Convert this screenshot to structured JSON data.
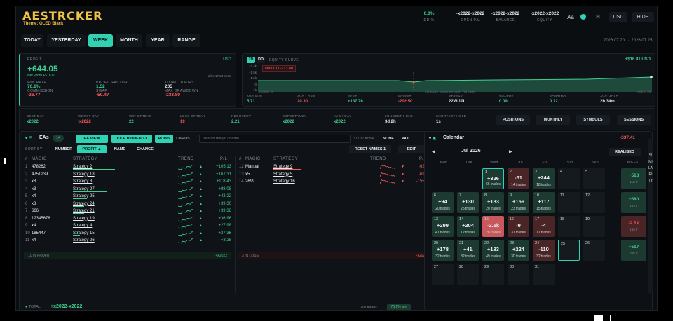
{
  "header": {
    "logo": "AESTRCKER",
    "theme": "Theme: OLED Black",
    "stats": [
      {
        "value": "0.0%",
        "label": "DD %",
        "color": "#3fd08f"
      },
      {
        "value": "-x2022-x2022",
        "label": "OPEN P/L",
        "color": "#e8ecef"
      },
      {
        "value": "-x2022-x2022",
        "label": "BALANCE",
        "color": "#e8ecef"
      },
      {
        "value": "-x2022-x2022",
        "label": "EQUITY",
        "color": "#e8ecef"
      }
    ],
    "aa": "Aa",
    "currency": "USD",
    "hide": "HIDE"
  },
  "tabs": [
    "TODAY",
    "YESTERDAY",
    "WEEK",
    "MONTH",
    "YEAR",
    "RANGE"
  ],
  "active_tab": "WEEK",
  "date_range": {
    "from": "2026.07.20",
    "arrow": "→",
    "to": "2026.07.25"
  },
  "profit": {
    "label": "PROFIT",
    "currency": "USD",
    "value": "+644.05",
    "net": "Net Profit +$16.81",
    "note": "after 17.24 costs",
    "stats": [
      {
        "l": "WIN RATE",
        "v": "76.1%",
        "c": "#3fd08f"
      },
      {
        "l": "PROFIT FACTOR",
        "v": "1.52",
        "c": "#3fd08f"
      },
      {
        "l": "TOTAL TRADES",
        "v": "205",
        "c": "#e8ecef"
      },
      {
        "l": "COMMISSION",
        "v": "-26.77",
        "c": "#ff5a5a"
      },
      {
        "l": "SWAP",
        "v": "-50.47",
        "c": "#ff5a5a"
      },
      {
        "l": "MAX DRAWDOWN",
        "v": "-233.80",
        "c": "#ff5a5a"
      }
    ]
  },
  "equity": {
    "btn1": "1D",
    "btn2": "DD",
    "title": "EQUITY CURVE",
    "total": "+$16.81 USD",
    "max_dd": "Max DD -233.80",
    "y_ticks": [
      "+2.4k",
      "+1.5k",
      "-1.5k",
      "0",
      "-1k"
    ],
    "x_from": "2026.07.20",
    "x_to": "2026.07.25",
    "mid_note": "231 trades · ignore net profit / 706 trades",
    "stats": [
      {
        "l": "AVG WIN",
        "v": "5.71",
        "c": "#3fd08f"
      },
      {
        "l": "AVG LOSS",
        "v": "20.30",
        "c": "#ff5a5a"
      },
      {
        "l": "BEST",
        "v": "+137.76",
        "c": "#3fd08f"
      },
      {
        "l": "WORST",
        "v": "-202.50",
        "c": "#ff5a5a"
      },
      {
        "l": "STREAK",
        "v": "22W/10L",
        "c": "#e8ecef"
      },
      {
        "l": "SHARPE",
        "v": "0.09",
        "c": "#3fd08f"
      },
      {
        "l": "SORTINO",
        "v": "0.12",
        "c": "#3fd08f"
      },
      {
        "l": "AVG HOLD",
        "v": "2h 34m",
        "c": "#e8ecef"
      }
    ]
  },
  "strip": {
    "stats": [
      {
        "l": "BEST DAY",
        "v": "x2022",
        "c": "#3fd08f"
      },
      {
        "l": "WORST DAY",
        "v": "-x2022",
        "c": "#ff5a5a"
      },
      {
        "l": "WIN STREAK",
        "v": "22",
        "c": "#3fd08f"
      },
      {
        "l": "LOSS STREAK",
        "v": "10",
        "c": "#ff5a5a"
      },
      {
        "l": "RECOVERY",
        "v": "2.21",
        "c": "#3fd08f"
      },
      {
        "l": "EXPECTANCY",
        "v": "x2022",
        "c": "#3fd08f"
      },
      {
        "l": "AVG / DAY",
        "v": "x2022",
        "c": "#3fd08f"
      },
      {
        "l": "LONGEST HOLD",
        "v": "3d 2h",
        "c": "#e8ecef"
      },
      {
        "l": "SHORTEST HOLD",
        "v": "1s",
        "c": "#e8ecef"
      }
    ],
    "buttons": [
      "POSITIONS",
      "MONTHLY",
      "SYMBOLS",
      "SESSIONS"
    ]
  },
  "eas": {
    "title": "EAs",
    "count": "14",
    "ea_view": "EA VIEW",
    "idle": "IDLE HIDDEN 13",
    "rows": "ROWS",
    "cards": "CARDS",
    "search_ph": "Search magic / name",
    "active": "37 / 37 active",
    "none": "NONE",
    "all": "ALL",
    "sort_by": "SORT BY",
    "sort": [
      "NUMBER",
      "PROFIT ▲",
      "NAME",
      "CHANGE"
    ],
    "reset": "RESET NAMES 1",
    "edit": "EDIT",
    "cols": {
      "num": "#",
      "magic": "MAGIC",
      "strategy": "STRATEGY",
      "trend": "TREND",
      "pl": "P/L"
    },
    "left": [
      {
        "n": "1",
        "m": "478262",
        "s": "Strategy 2",
        "pl": "+105.13",
        "w": 60
      },
      {
        "n": "2",
        "m": "4751239",
        "s": "Strategy 18",
        "pl": "+167.31",
        "w": 92
      },
      {
        "n": "3",
        "m": "x8",
        "s": "Strategy 3",
        "pl": "+118.43",
        "w": 70
      },
      {
        "n": "4",
        "m": "x3",
        "s": "Strategy 27",
        "pl": "+88.08",
        "w": 48
      },
      {
        "n": "5",
        "m": "x4",
        "s": "Strategy 25",
        "pl": "+43.22",
        "w": 20
      },
      {
        "n": "6",
        "m": "x3",
        "s": "Strategy 24",
        "pl": "+39.30",
        "w": 16
      },
      {
        "n": "7",
        "m": "666",
        "s": "Strategy 21",
        "pl": "+39.38",
        "w": 16
      },
      {
        "n": "8",
        "m": "12345678",
        "s": "Strategy 19",
        "pl": "+36.96",
        "w": 14
      },
      {
        "n": "9",
        "m": "x4",
        "s": "Strategy 4",
        "pl": "+27.98",
        "w": 10
      },
      {
        "n": "10",
        "m": "185447",
        "s": "Strategy 15",
        "pl": "+27.36",
        "w": 10
      },
      {
        "n": "11",
        "m": "x4",
        "s": "Strategy 26",
        "pl": "+3.28",
        "w": 4
      }
    ],
    "right": [
      {
        "n": "12",
        "m": "Manual",
        "s": "Strategy 9",
        "pl": "-62.21",
        "w": 40
      },
      {
        "n": "13",
        "m": "x5",
        "s": "Strategy 5",
        "pl": "-69.40",
        "w": 46
      },
      {
        "n": "14",
        "m": "2699",
        "s": "Strategy 16",
        "pl": "-155.43",
        "w": 66
      }
    ],
    "in_profit": "11 IN PROFIT",
    "in_profit_v": "+x2022",
    "in_loss": "3 IN LOSS",
    "in_loss_v": "-x2022",
    "total_label": "TOTAL",
    "total_v": "+x2022-x2022",
    "total_trades": "205 trades",
    "win": "76.1% win"
  },
  "calendar": {
    "title": "Calendar",
    "total": "-337.41",
    "month": "Jul 2026",
    "realised": "REALISED",
    "side": "SIMILARITY",
    "days": [
      "Mon",
      "Tue",
      "Wed",
      "Thu",
      "Fri",
      "Sat",
      "Sun",
      "WEEK"
    ],
    "cells": [
      [
        {
          "d": "",
          "k": "e"
        },
        {
          "d": "",
          "k": "e"
        },
        {
          "d": "1",
          "p": "+326",
          "t": "66 trades",
          "k": "gr sel"
        },
        {
          "d": "2",
          "p": "-51",
          "t": "14 trades",
          "k": "rd"
        },
        {
          "d": "3",
          "p": "+244",
          "t": "18 trades",
          "k": "gr"
        },
        {
          "d": "4",
          "k": ""
        },
        {
          "d": "5",
          "k": ""
        }
      ],
      [
        {
          "d": "6",
          "p": "+94",
          "t": "20 trades",
          "k": "gr"
        },
        {
          "d": "7",
          "p": "+130",
          "t": "25 trades",
          "k": "gr"
        },
        {
          "d": "8",
          "p": "+183",
          "t": "20 trades",
          "k": "gr"
        },
        {
          "d": "9",
          "p": "+156",
          "t": "23 trades",
          "k": "gr"
        },
        {
          "d": "10",
          "p": "+117",
          "t": "15 trades",
          "k": "gr"
        },
        {
          "d": "11",
          "k": ""
        },
        {
          "d": "12",
          "k": ""
        }
      ],
      [
        {
          "d": "13",
          "p": "+299",
          "t": "47 trades",
          "k": "gr"
        },
        {
          "d": "14",
          "p": "+204",
          "t": "12 trades",
          "k": "gr"
        },
        {
          "d": "15",
          "p": "-2.5k",
          "t": "28 trades",
          "k": "bad"
        },
        {
          "d": "16",
          "p": "-9",
          "t": "37 trades",
          "k": "rd"
        },
        {
          "d": "17",
          "p": "-4",
          "t": "17 trades",
          "k": "rd"
        },
        {
          "d": "18",
          "k": ""
        },
        {
          "d": "19",
          "k": ""
        }
      ],
      [
        {
          "d": "20",
          "p": "+178",
          "t": "32 trades",
          "k": "gr"
        },
        {
          "d": "21",
          "p": "+41",
          "t": "82 trades",
          "k": "gr"
        },
        {
          "d": "22",
          "p": "+183",
          "t": "49 trades",
          "k": "gr"
        },
        {
          "d": "23",
          "p": "+224",
          "t": "30 trades",
          "k": "gr"
        },
        {
          "d": "24",
          "p": "-110",
          "t": "32 trades",
          "k": "rd"
        },
        {
          "d": "25",
          "k": "sel"
        },
        {
          "d": "26",
          "k": ""
        }
      ],
      [
        {
          "d": "27",
          "k": ""
        },
        {
          "d": "28",
          "k": ""
        },
        {
          "d": "29",
          "k": ""
        },
        {
          "d": "30",
          "k": ""
        },
        {
          "d": "31",
          "k": ""
        },
        {
          "d": "",
          "k": "e"
        },
        {
          "d": "",
          "k": "e"
        }
      ]
    ],
    "weeks": [
      {
        "v": "+518",
        "s": "118 tr",
        "c": "#3fd08f",
        "bg": "#1d3a30"
      },
      {
        "v": "+680",
        "s": "103 tr",
        "c": "#3fd08f",
        "bg": "#1d3a30"
      },
      {
        "v": "-2.1k",
        "s": "156 tr",
        "c": "#ff5a5a",
        "bg": "#4a2526"
      },
      {
        "v": "+517",
        "s": "225 tr",
        "c": "#3fd08f",
        "bg": "#1d3a30"
      }
    ]
  }
}
